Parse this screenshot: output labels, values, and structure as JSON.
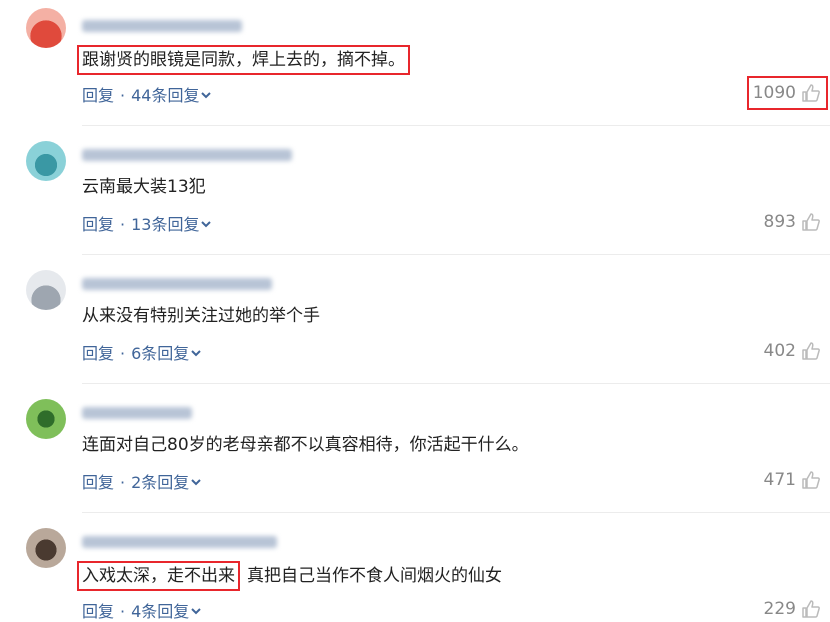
{
  "comments": [
    {
      "text": "跟谢贤的眼镜是同款，焊上去的，摘不掉。",
      "text_after": "",
      "reply_label": "回复",
      "replies_label": "44条回复",
      "likes": "1090",
      "highlight_text": true,
      "highlight_likes": true,
      "avatar_colors": [
        "#f08a7a",
        "#e04a3c"
      ]
    },
    {
      "text": "云南最大装13犯",
      "text_after": "",
      "reply_label": "回复",
      "replies_label": "13条回复",
      "likes": "893",
      "highlight_text": false,
      "highlight_likes": false,
      "avatar_colors": [
        "#7bc8cf",
        "#3a98a4"
      ]
    },
    {
      "text": "从来没有特别关注过她的举个手",
      "text_after": "",
      "reply_label": "回复",
      "replies_label": "6条回复",
      "likes": "402",
      "highlight_text": false,
      "highlight_likes": false,
      "avatar_colors": [
        "#dfe3e8",
        "#9ea6b0"
      ]
    },
    {
      "text": "连面对自己80岁的老母亲都不以真容相待，你活起干什么。",
      "text_after": "",
      "reply_label": "回复",
      "replies_label": "2条回复",
      "likes": "471",
      "highlight_text": false,
      "highlight_likes": false,
      "avatar_colors": [
        "#7fbf5a",
        "#2f6d2a"
      ]
    },
    {
      "text": "入戏太深，走不出来",
      "text_after": "真把自己当作不食人间烟火的仙女",
      "reply_label": "回复",
      "replies_label": "4条回复",
      "likes": "229",
      "highlight_text": true,
      "highlight_likes": false,
      "avatar_colors": [
        "#b9a89a",
        "#4a3a30"
      ]
    }
  ]
}
